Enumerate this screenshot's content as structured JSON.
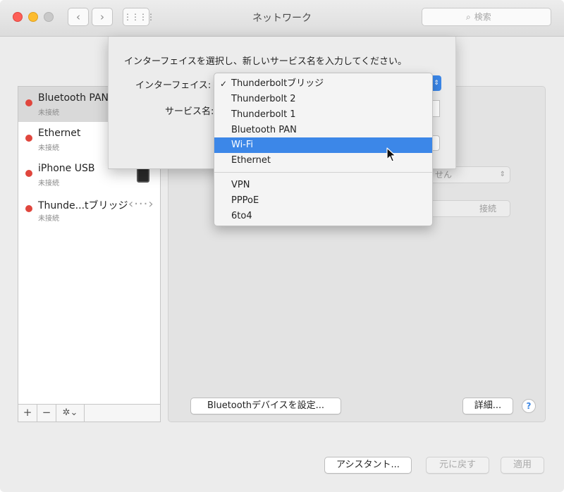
{
  "window": {
    "title": "ネットワーク",
    "search_placeholder": "検索",
    "nav_back": "‹",
    "nav_forward": "›",
    "grid_icon": "⋮⋮⋮⋮"
  },
  "services": [
    {
      "name": "Bluetooth PAN",
      "status": "未接続",
      "selected": true
    },
    {
      "name": "Ethernet",
      "status": "未接続",
      "selected": false
    },
    {
      "name": "iPhone USB",
      "status": "未接続",
      "selected": false
    },
    {
      "name": "Thunde...tブリッジ",
      "status": "未接続",
      "selected": false
    }
  ],
  "list_controls": {
    "add": "+",
    "remove": "−",
    "gear": "✲⌄"
  },
  "thunderbolt_icon_glyph": "‹···›",
  "sheet": {
    "prompt": "インターフェイスを選択し、新しいサービス名を入力してください。",
    "interface_label": "インターフェイス:",
    "service_name_label": "サービス名:"
  },
  "interface_menu": {
    "items": [
      {
        "label": "Thunderboltブリッジ",
        "checked": true
      },
      {
        "label": "Thunderbolt 2"
      },
      {
        "label": "Thunderbolt 1"
      },
      {
        "label": "Bluetooth PAN"
      },
      {
        "label": "Wi-Fi",
        "highlighted": true
      },
      {
        "label": "Ethernet"
      },
      {
        "label": "VPN"
      },
      {
        "label": "PPPoE"
      },
      {
        "label": "6to4"
      }
    ],
    "check_glyph": "✓"
  },
  "detail": {
    "faded_select_text": "せん",
    "faded_button": "接続",
    "bluetooth_setup_button": "Bluetoothデバイスを設定...",
    "details_button": "詳細...",
    "help_button": "?"
  },
  "footer": {
    "assistant": "アシスタント...",
    "revert": "元に戻す",
    "apply": "適用"
  },
  "colors": {
    "status_red": "#e0463d",
    "highlight_blue": "#3c87e8",
    "close_red": "#fd5f57",
    "minimize_yellow": "#fdbc2e"
  }
}
